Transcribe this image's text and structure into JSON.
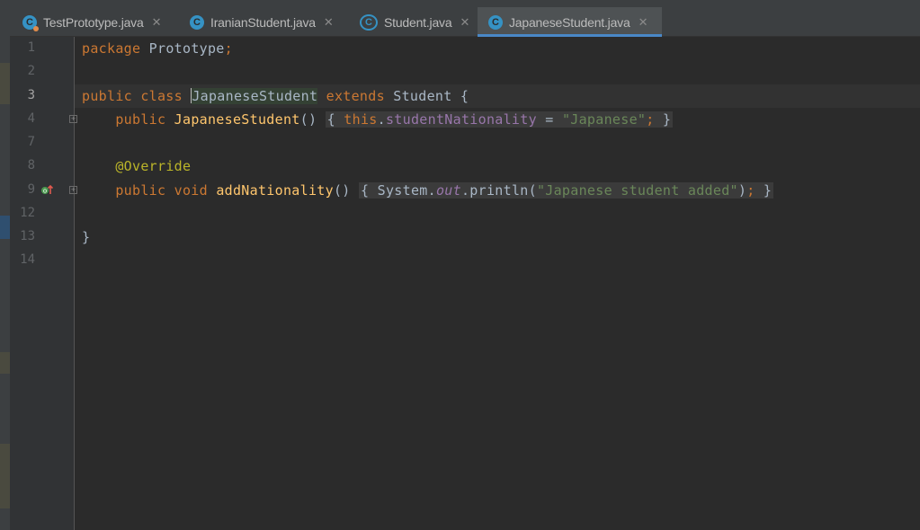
{
  "tabs": [
    {
      "label": "TestPrototype.java",
      "icon": "class-icon-with-main",
      "active": false
    },
    {
      "label": "IranianStudent.java",
      "icon": "class-icon",
      "active": false
    },
    {
      "label": "Student.java",
      "icon": "abstract-class-icon",
      "active": false
    },
    {
      "label": "JapaneseStudent.java",
      "icon": "class-icon",
      "active": true
    }
  ],
  "close_glyph": "✕",
  "class_glyph": "C",
  "editor": {
    "line_numbers": [
      "1",
      "2",
      "3",
      "4",
      "7",
      "8",
      "9",
      "12",
      "13",
      "14"
    ],
    "current_line": "3",
    "code": {
      "l1": {
        "kw": "package",
        "text": " Prototype",
        "semi": ";"
      },
      "l3": {
        "kw1": "public class ",
        "name": "JapaneseStudent",
        "kw2": " extends ",
        "parent": "Student {"
      },
      "l4": {
        "kw": "public ",
        "fn": "JapaneseStudent",
        "paren": "() ",
        "open": "{ ",
        "this": "this",
        "dot": ".",
        "field": "studentNationality",
        "eq": " = ",
        "str": "\"Japanese\"",
        "semi": ";",
        "close": " }"
      },
      "l8": {
        "ann": "@Override"
      },
      "l9": {
        "kw": "public void ",
        "fn": "addNationality",
        "paren": "() ",
        "open": "{ ",
        "sys": "System.",
        "out": "out",
        "print": ".println(",
        "str": "\"Japanese student added\"",
        "end": ")",
        "semi": ";",
        "close": " }"
      },
      "l13": {
        "text": "}"
      }
    }
  },
  "colors": {
    "background": "#2b2b2b",
    "keyword": "#cc7832",
    "method": "#ffc66d",
    "string": "#6a8759",
    "field": "#9876aa",
    "annotation": "#bbb529",
    "tab_active_underline": "#4a88c7"
  }
}
